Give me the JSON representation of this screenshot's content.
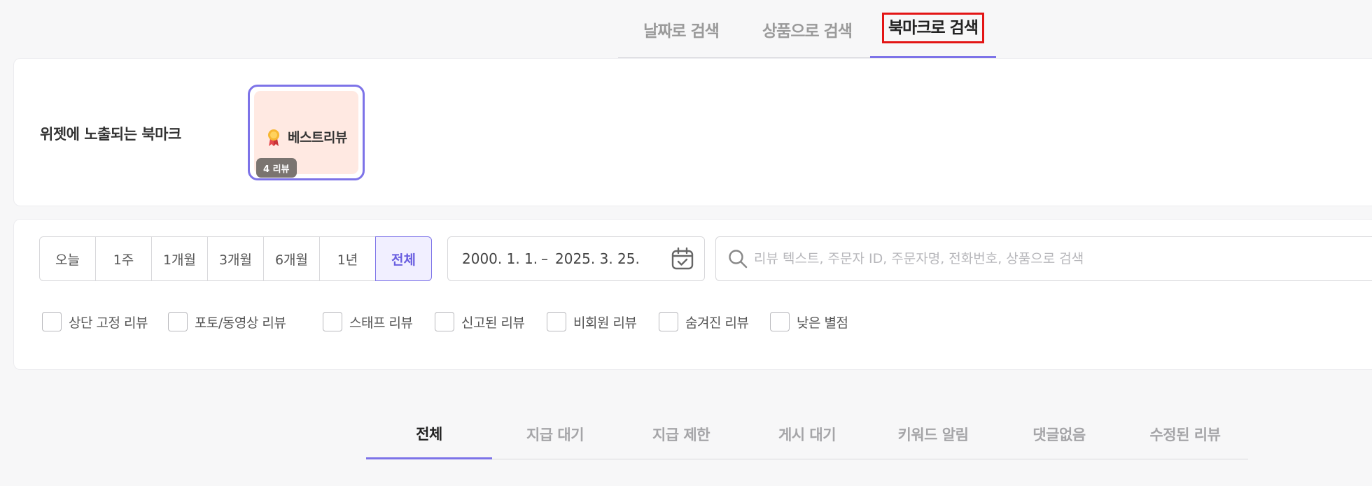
{
  "mode_tabs": [
    "날짜로 검색",
    "상품으로 검색",
    "북마크로 검색"
  ],
  "bookmark": {
    "label": "위젯에 노출되는 북마크",
    "chip_name": "베스트리뷰",
    "chip_count": "4 리뷰",
    "chip_icon": "medal-icon"
  },
  "period": {
    "options": [
      "오늘",
      "1주",
      "1개월",
      "3개월",
      "6개월",
      "1년",
      "전체"
    ],
    "selected": "전체"
  },
  "date_range": {
    "start": "2000. 1. 1.",
    "separator": "–",
    "end": "2025. 3. 25."
  },
  "search": {
    "placeholder": "리뷰 텍스트, 주문자 ID, 주문자명, 전화번호, 상품으로 검색",
    "value": ""
  },
  "filters": [
    "상단 고정 리뷰",
    "포토/동영상 리뷰",
    "스태프 리뷰",
    "신고된 리뷰",
    "비회원 리뷰",
    "숨겨진 리뷰",
    "낮은 별점"
  ],
  "status_tabs": [
    "전체",
    "지급 대기",
    "지급 제한",
    "게시 대기",
    "키워드 알림",
    "댓글없음",
    "수정된 리뷰"
  ],
  "colors": {
    "accent": "#7d73e8",
    "highlight_box": "#e31515",
    "chip_bg": "#ffe9e2"
  }
}
